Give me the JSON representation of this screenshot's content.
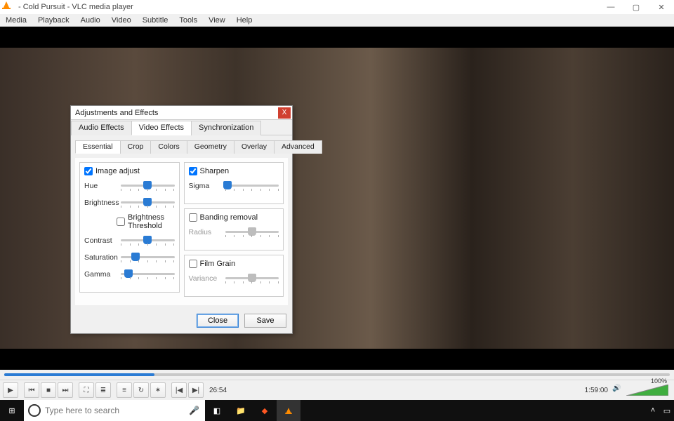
{
  "window": {
    "title": "- Cold Pursuit - VLC media player",
    "min": "—",
    "max": "▢",
    "close": "✕"
  },
  "menubar": [
    "Media",
    "Playback",
    "Audio",
    "Video",
    "Subtitle",
    "Tools",
    "View",
    "Help"
  ],
  "playback": {
    "current_time": "26:54",
    "total_time": "1:59:00",
    "progress_fraction": 0.226,
    "volume_pct": "100%"
  },
  "control_buttons": {
    "play": "▶",
    "skip_back": "⏮",
    "stop": "■",
    "skip_fwd": "⏭",
    "fullscreen": "⛶",
    "ext_playlist": "≣",
    "playlist": "≡",
    "loop": "↻",
    "shuffle": "✶",
    "prev_frame": "|◀",
    "next_frame": "▶|"
  },
  "dialog": {
    "title": "Adjustments and Effects",
    "close_glyph": "X",
    "tabs_outer": [
      "Audio Effects",
      "Video Effects",
      "Synchronization"
    ],
    "tabs_outer_active": 1,
    "tabs_inner": [
      "Essential",
      "Crop",
      "Colors",
      "Geometry",
      "Overlay",
      "Advanced"
    ],
    "tabs_inner_active": 0,
    "image_adjust": {
      "label": "Image adjust",
      "checked": true,
      "brightness_threshold_label": "Brightness Threshold",
      "brightness_threshold_checked": false,
      "sliders": {
        "Hue": {
          "pos": 0.5
        },
        "Brightness": {
          "pos": 0.5
        },
        "Contrast": {
          "pos": 0.5
        },
        "Saturation": {
          "pos": 0.27
        },
        "Gamma": {
          "pos": 0.14
        }
      }
    },
    "sharpen": {
      "label": "Sharpen",
      "checked": true,
      "sigma_label": "Sigma",
      "sigma_pos": 0.05
    },
    "banding": {
      "label": "Banding removal",
      "checked": false,
      "radius_label": "Radius",
      "radius_pos": 0.5
    },
    "film_grain": {
      "label": "Film Grain",
      "checked": false,
      "variance_label": "Variance",
      "variance_pos": 0.5
    },
    "buttons": {
      "close": "Close",
      "save": "Save"
    }
  },
  "taskbar": {
    "search_placeholder": "Type here to search",
    "icons": {
      "start": "⊞",
      "cortana_mic": "🎤",
      "taskview": "◧"
    }
  }
}
